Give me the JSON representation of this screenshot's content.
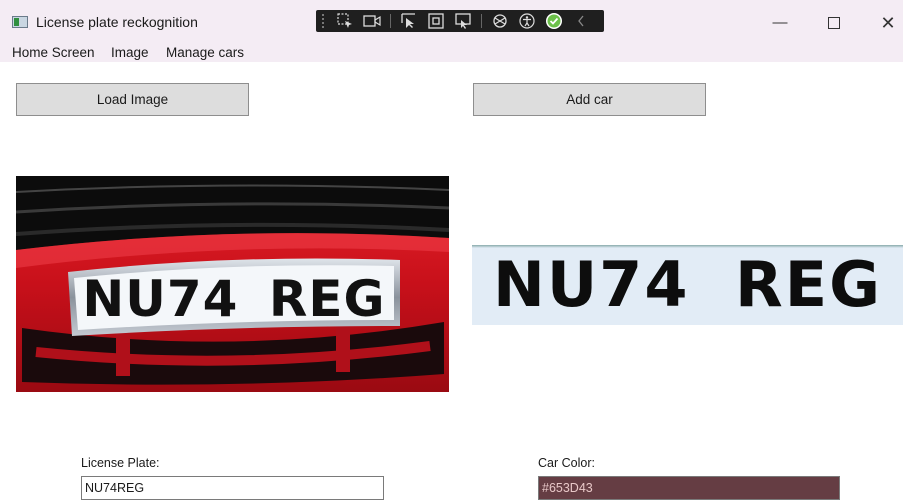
{
  "window": {
    "title": "License plate reckognition",
    "minimize_glyph": "—",
    "close_glyph": "✕"
  },
  "debug_toolbar": {
    "icons": [
      "select-element-icon",
      "video-icon",
      "pointer-icon",
      "box-icon",
      "display-layout-icon",
      "hot-reload-icon",
      "accessibility-icon",
      "checkmark-icon",
      "collapse-icon"
    ],
    "accent_green": "#6cc04a"
  },
  "menu": {
    "items": [
      {
        "label": "Home Screen"
      },
      {
        "label": "Image"
      },
      {
        "label": "Manage cars"
      }
    ]
  },
  "buttons": {
    "load_image": "Load Image",
    "add_car": "Add car"
  },
  "images": {
    "car_plate_text": "NU74 REG",
    "cropped_plate_text": "NU74 REG",
    "car_color": "#d0141c"
  },
  "form": {
    "license_plate_label": "License Plate:",
    "license_plate_value": "NU74REG",
    "car_color_label": "Car Color:",
    "car_color_value": "#653D43",
    "car_color_swatch": "#653D43"
  }
}
